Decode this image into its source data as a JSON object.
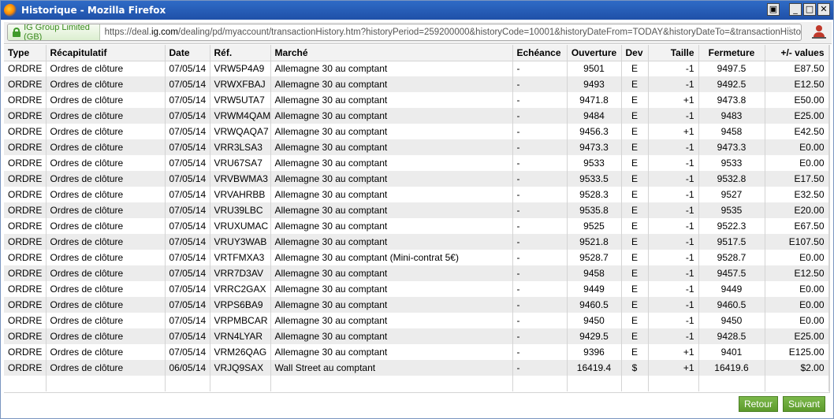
{
  "window": {
    "title": "Historique - Mozilla Firefox",
    "buttons": [
      "▣",
      "_",
      "□",
      "✕"
    ]
  },
  "urlbar": {
    "identity": "IG Group Limited (GB)",
    "url_prefix": "https://deal.",
    "url_domain": "ig.com",
    "url_rest": "/dealing/pd/myaccount/transactionHistory.htm?historyPeriod=259200000&historyCode=10001&historyDateFrom=TODAY&historyDateTo=&transactionHisto"
  },
  "table": {
    "columns": [
      "Type",
      "Récapitulatif",
      "Date",
      "Réf.",
      "Marché",
      "Echéance",
      "Ouverture",
      "Dev",
      "Taille",
      "Fermeture",
      "+/- values"
    ],
    "rows": [
      [
        "ORDRE",
        "Ordres de clôture",
        "07/05/14",
        "VRW5P4A9",
        "Allemagne 30 au comptant",
        "-",
        "9501",
        "E",
        "-1",
        "9497.5",
        "E87.50"
      ],
      [
        "ORDRE",
        "Ordres de clôture",
        "07/05/14",
        "VRWXFBAJ",
        "Allemagne 30 au comptant",
        "-",
        "9493",
        "E",
        "-1",
        "9492.5",
        "E12.50"
      ],
      [
        "ORDRE",
        "Ordres de clôture",
        "07/05/14",
        "VRW5UTA7",
        "Allemagne 30 au comptant",
        "-",
        "9471.8",
        "E",
        "+1",
        "9473.8",
        "E50.00"
      ],
      [
        "ORDRE",
        "Ordres de clôture",
        "07/05/14",
        "VRWM4QAM",
        "Allemagne 30 au comptant",
        "-",
        "9484",
        "E",
        "-1",
        "9483",
        "E25.00"
      ],
      [
        "ORDRE",
        "Ordres de clôture",
        "07/05/14",
        "VRWQAQA7",
        "Allemagne 30 au comptant",
        "-",
        "9456.3",
        "E",
        "+1",
        "9458",
        "E42.50"
      ],
      [
        "ORDRE",
        "Ordres de clôture",
        "07/05/14",
        "VRR3LSA3",
        "Allemagne 30 au comptant",
        "-",
        "9473.3",
        "E",
        "-1",
        "9473.3",
        "E0.00"
      ],
      [
        "ORDRE",
        "Ordres de clôture",
        "07/05/14",
        "VRU67SA7",
        "Allemagne 30 au comptant",
        "-",
        "9533",
        "E",
        "-1",
        "9533",
        "E0.00"
      ],
      [
        "ORDRE",
        "Ordres de clôture",
        "07/05/14",
        "VRVBWMA3",
        "Allemagne 30 au comptant",
        "-",
        "9533.5",
        "E",
        "-1",
        "9532.8",
        "E17.50"
      ],
      [
        "ORDRE",
        "Ordres de clôture",
        "07/05/14",
        "VRVAHRBB",
        "Allemagne 30 au comptant",
        "-",
        "9528.3",
        "E",
        "-1",
        "9527",
        "E32.50"
      ],
      [
        "ORDRE",
        "Ordres de clôture",
        "07/05/14",
        "VRU39LBC",
        "Allemagne 30 au comptant",
        "-",
        "9535.8",
        "E",
        "-1",
        "9535",
        "E20.00"
      ],
      [
        "ORDRE",
        "Ordres de clôture",
        "07/05/14",
        "VRUXUMAC",
        "Allemagne 30 au comptant",
        "-",
        "9525",
        "E",
        "-1",
        "9522.3",
        "E67.50"
      ],
      [
        "ORDRE",
        "Ordres de clôture",
        "07/05/14",
        "VRUY3WAB",
        "Allemagne 30 au comptant",
        "-",
        "9521.8",
        "E",
        "-1",
        "9517.5",
        "E107.50"
      ],
      [
        "ORDRE",
        "Ordres de clôture",
        "07/05/14",
        "VRTFMXA3",
        "Allemagne 30 au comptant (Mini-contrat 5€)",
        "-",
        "9528.7",
        "E",
        "-1",
        "9528.7",
        "E0.00"
      ],
      [
        "ORDRE",
        "Ordres de clôture",
        "07/05/14",
        "VRR7D3AV",
        "Allemagne 30 au comptant",
        "-",
        "9458",
        "E",
        "-1",
        "9457.5",
        "E12.50"
      ],
      [
        "ORDRE",
        "Ordres de clôture",
        "07/05/14",
        "VRRC2GAX",
        "Allemagne 30 au comptant",
        "-",
        "9449",
        "E",
        "-1",
        "9449",
        "E0.00"
      ],
      [
        "ORDRE",
        "Ordres de clôture",
        "07/05/14",
        "VRPS6BA9",
        "Allemagne 30 au comptant",
        "-",
        "9460.5",
        "E",
        "-1",
        "9460.5",
        "E0.00"
      ],
      [
        "ORDRE",
        "Ordres de clôture",
        "07/05/14",
        "VRPMBCAR",
        "Allemagne 30 au comptant",
        "-",
        "9450",
        "E",
        "-1",
        "9450",
        "E0.00"
      ],
      [
        "ORDRE",
        "Ordres de clôture",
        "07/05/14",
        "VRN4LYAR",
        "Allemagne 30 au comptant",
        "-",
        "9429.5",
        "E",
        "-1",
        "9428.5",
        "E25.00"
      ],
      [
        "ORDRE",
        "Ordres de clôture",
        "07/05/14",
        "VRM26QAG",
        "Allemagne 30 au comptant",
        "-",
        "9396",
        "E",
        "+1",
        "9401",
        "E125.00"
      ],
      [
        "ORDRE",
        "Ordres de clôture",
        "06/05/14",
        "VRJQ9SAX",
        "Wall Street au comptant",
        "-",
        "16419.4",
        "$",
        "+1",
        "16419.6",
        "$2.00"
      ]
    ]
  },
  "pager": {
    "prev_label": "Retour",
    "next_label": "Suivant"
  },
  "colors": {
    "titlebar": "#2f6bc6",
    "row_alt": "#ececec",
    "button_green": "#6aa83a",
    "secure_green": "#3a8a1e"
  }
}
